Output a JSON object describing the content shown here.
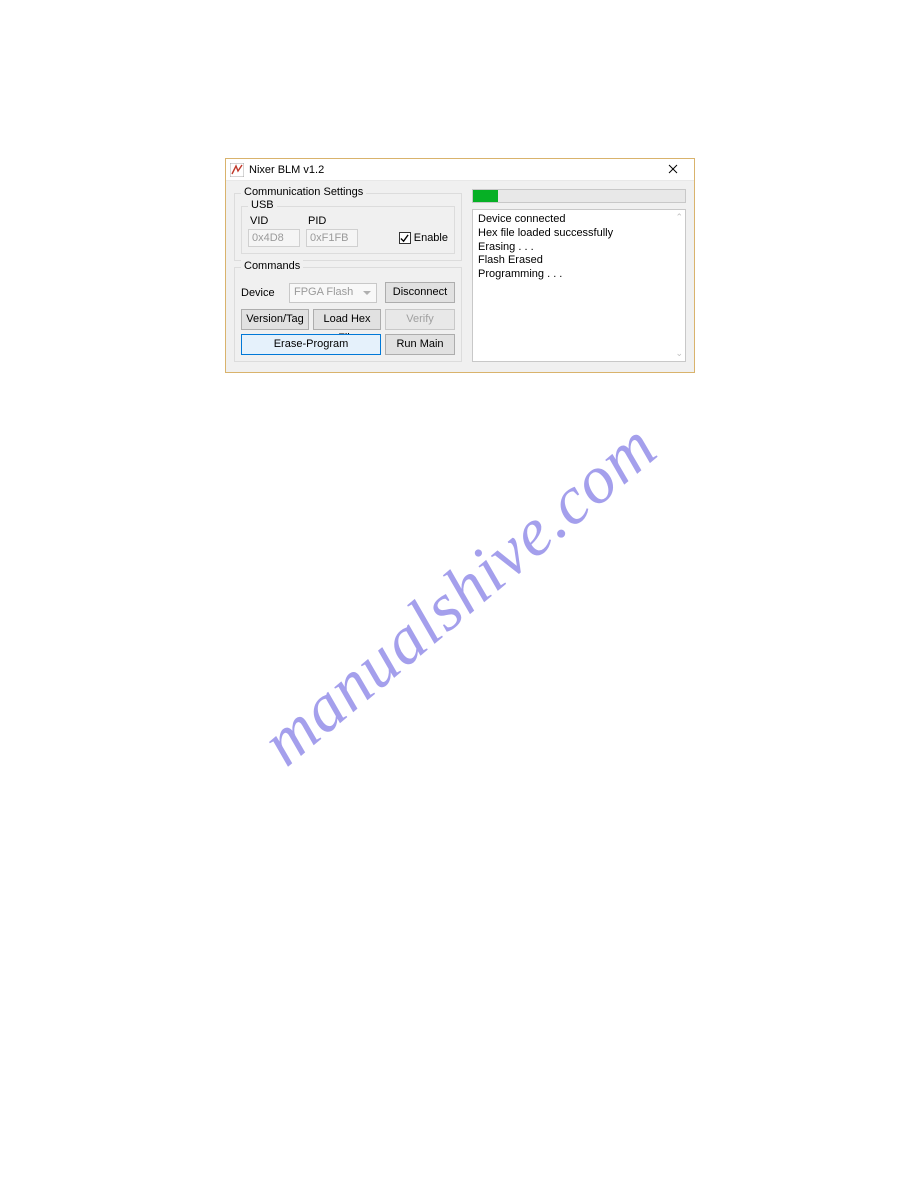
{
  "window": {
    "title": "Nixer BLM v1.2"
  },
  "comm": {
    "group_label": "Communication Settings",
    "usb_label": "USB",
    "vid_label": "VID",
    "pid_label": "PID",
    "vid_value": "0x4D8",
    "pid_value": "0xF1FB",
    "enable_label": "Enable",
    "enable_checked": true
  },
  "commands": {
    "group_label": "Commands",
    "device_label": "Device",
    "device_value": "FPGA Flash",
    "disconnect": "Disconnect",
    "version_tag": "Version/Tag",
    "load_hex": "Load Hex File",
    "verify": "Verify",
    "erase_program": "Erase-Program",
    "run_main": "Run Main"
  },
  "progress": {
    "percent": 12
  },
  "log": {
    "lines": [
      "Device connected",
      "Hex file loaded successfully",
      "Erasing . . .",
      "Flash Erased",
      "Programming . . ."
    ]
  },
  "watermark": "manualshive.com"
}
